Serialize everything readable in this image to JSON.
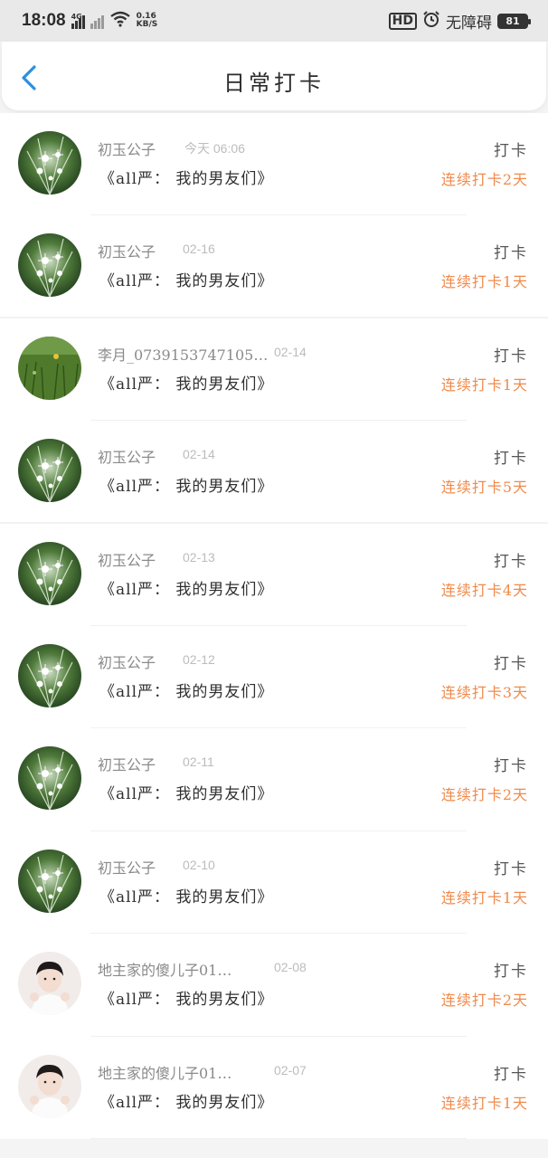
{
  "status_bar": {
    "time": "18:08",
    "network": "4G",
    "speed_value": "0.16",
    "speed_unit": "KB/S",
    "hd_label": "HD",
    "accessibility": "无障碍",
    "battery": "81"
  },
  "header": {
    "title": "日常打卡"
  },
  "entries": [
    {
      "name": "初玉公子",
      "date": "今天 06:06",
      "book": "《all严： 我的男友们》",
      "action": "打卡",
      "streak": "连续打卡2天",
      "avatar": "grass-icon"
    },
    {
      "name": "初玉公子",
      "date": "02-16",
      "book": "《all严： 我的男友们》",
      "action": "打卡",
      "streak": "连续打卡1天",
      "avatar": "grass-icon"
    },
    {
      "name": "李月_0739153747105…",
      "date": "02-14",
      "book": "《all严： 我的男友们》",
      "action": "打卡",
      "streak": "连续打卡1天",
      "avatar": "meadow-icon"
    },
    {
      "name": "初玉公子",
      "date": "02-14",
      "book": "《all严： 我的男友们》",
      "action": "打卡",
      "streak": "连续打卡5天",
      "avatar": "grass-icon"
    },
    {
      "name": "初玉公子",
      "date": "02-13",
      "book": "《all严： 我的男友们》",
      "action": "打卡",
      "streak": "连续打卡4天",
      "avatar": "grass-icon"
    },
    {
      "name": "初玉公子",
      "date": "02-12",
      "book": "《all严： 我的男友们》",
      "action": "打卡",
      "streak": "连续打卡3天",
      "avatar": "grass-icon"
    },
    {
      "name": "初玉公子",
      "date": "02-11",
      "book": "《all严： 我的男友们》",
      "action": "打卡",
      "streak": "连续打卡2天",
      "avatar": "grass-icon"
    },
    {
      "name": "初玉公子",
      "date": "02-10",
      "book": "《all严： 我的男友们》",
      "action": "打卡",
      "streak": "连续打卡1天",
      "avatar": "grass-icon"
    },
    {
      "name": "地主家的傻儿子01…",
      "date": "02-08",
      "book": "《all严： 我的男友们》",
      "action": "打卡",
      "streak": "连续打卡2天",
      "avatar": "person-icon"
    },
    {
      "name": "地主家的傻儿子01…",
      "date": "02-07",
      "book": "《all严： 我的男友们》",
      "action": "打卡",
      "streak": "连续打卡1天",
      "avatar": "person-icon"
    }
  ],
  "colors": {
    "accent_blue": "#2d8fe0",
    "streak_orange": "#f08a4b"
  }
}
